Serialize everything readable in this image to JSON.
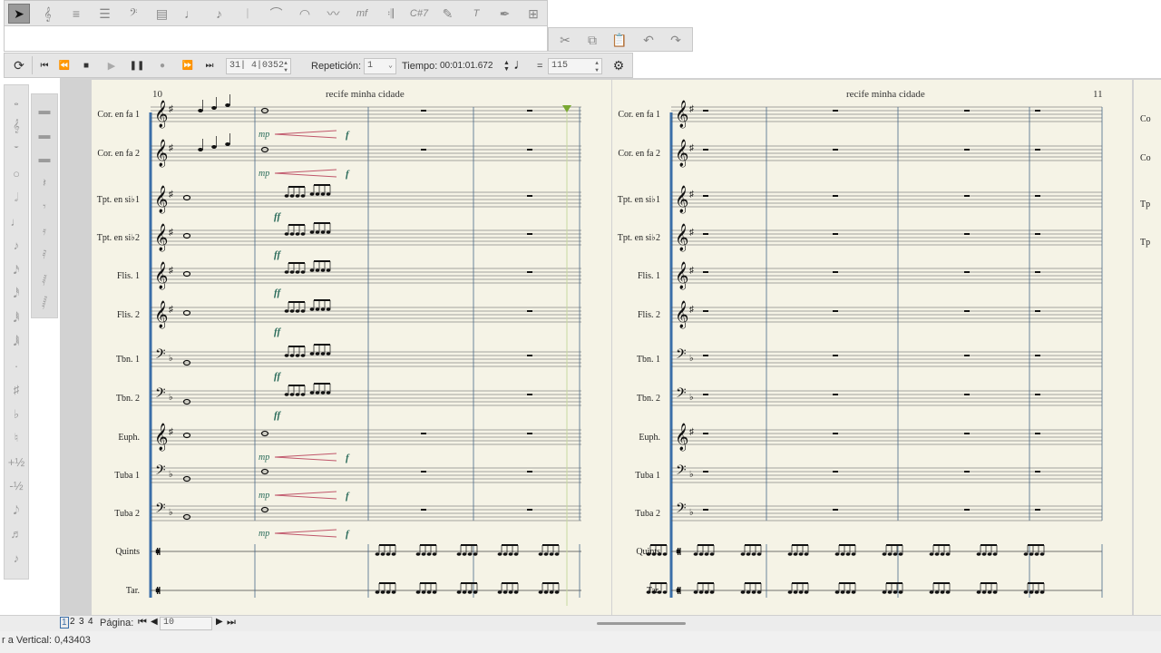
{
  "toolbar": {
    "palette_icons": [
      "select-arrow-icon",
      "note-input-icon",
      "measure-icon",
      "bars-icon",
      "bass-clef-icon",
      "staff-icon",
      "quarter-note-icon",
      "eighth-note-icon",
      "barline-icon",
      "slur-icon",
      "tie-icon",
      "ornament-icon",
      "dynamic-mf-icon",
      "repeat-icon",
      "chord-symbol-icon",
      "pencil-icon",
      "text-icon",
      "music-pen-icon",
      "add-measure-icon"
    ],
    "dynamic_label": "mf",
    "chord_label": "C#7",
    "text_label": "T"
  },
  "edit_toolbar": {
    "icons": [
      "cut-icon",
      "copy-icon",
      "paste-icon",
      "undo-icon",
      "redo-icon"
    ]
  },
  "transport": {
    "position_value": "31| 4|0352",
    "repetition_label": "Repetición:",
    "repetition_value": "1",
    "time_label": "Tiempo:",
    "time_value": "00:01:01.672",
    "equals": "=",
    "tempo_value": "115"
  },
  "score": {
    "left_page": {
      "number": "10",
      "title": "recife minha cidade"
    },
    "right_page": {
      "number": "11",
      "title": "recife minha cidade"
    },
    "instruments": [
      "Cor. en fa 1",
      "Cor. en fa 2",
      "Tpt. en si♭1",
      "Tpt. en si♭2",
      "Flis. 1",
      "Flis. 2",
      "Tbn. 1",
      "Tbn. 2",
      "Euph.",
      "Tuba 1",
      "Tuba 2",
      "Quints",
      "Tar."
    ],
    "right_edge_labels": [
      "Co",
      "Co",
      "Tp",
      "Tp"
    ],
    "dynamics": {
      "mp": "mp",
      "f": "f",
      "ff": "ff"
    }
  },
  "navigation": {
    "pages": [
      "1",
      "2",
      "3",
      "4"
    ],
    "current_page": "1",
    "page_label": "Página:",
    "page_input": "10"
  },
  "status": {
    "text": "r a Vertical: 0,43403"
  },
  "colors": {
    "accent": "#7aa832",
    "dynamic": "#2a6b5a",
    "hairpin": "#c0566a",
    "paper": "#f5f3e6",
    "system_line": "#3a6ea8"
  }
}
